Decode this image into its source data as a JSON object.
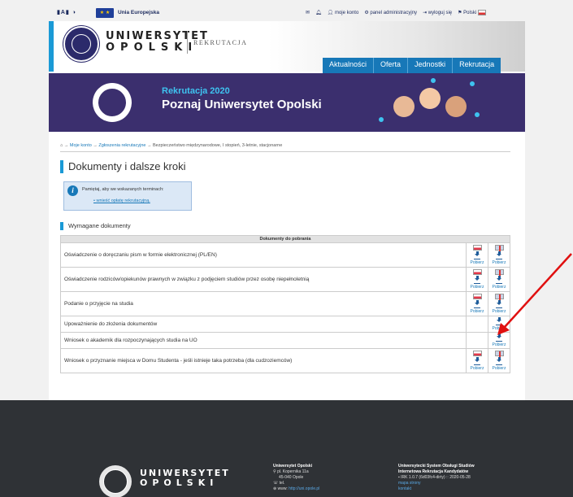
{
  "topbar": {
    "accessibility": "▮A▮ ◑",
    "eu_text": "Unia Europejska",
    "links": [
      "moje konto",
      "panel administracyjny",
      "wyloguj się",
      "Polski"
    ]
  },
  "header": {
    "brand_line1": "UNIWERSYTET",
    "brand_line2": "OPOLSKI",
    "section": "REKRUTACJA"
  },
  "nav": {
    "items": [
      "Aktualności",
      "Oferta",
      "Jednostki",
      "Rekrutacja"
    ]
  },
  "banner": {
    "line1": "Rekrutacja 2020",
    "line2": "Poznaj Uniwersytet Opolski"
  },
  "breadcrumb": {
    "items": [
      "Moje konto",
      "Zgłoszenia rekrutacyjne",
      "Bezpieczeństwo międzynarodowe, I stopień, 3-letnie, stacjonarne"
    ],
    "separator": "→"
  },
  "page_title": "Dokumenty i dalsze kroki",
  "notice": {
    "text": "Pamiętaj, aby we wskazanych terminach:",
    "link": "wnieść opłatę rekrutacyjną."
  },
  "section_title": "Wymagane dokumenty",
  "table": {
    "header": "Dokumenty do pobrania",
    "download_label": "Pobierz",
    "rows": [
      {
        "name": "Oświadczenie o doręczaniu pism w formie elektronicznej (PL/EN)",
        "pl": true,
        "en": true
      },
      {
        "name": "Oświadczenie rodziców/opiekunów prawnych w związku z podjęciem studiów przez osobę niepełnoletnią",
        "pl": true,
        "en": true
      },
      {
        "name": "Podanie o przyjęcie na studia",
        "pl": true,
        "en": true
      },
      {
        "name": "Upoważnienie do złożenia dokumentów",
        "pl": false,
        "en": true
      },
      {
        "name": "Wniosek o akademik dla rozpoczynających studia na UO",
        "pl": false,
        "en": true
      },
      {
        "name": "Wniosek o przyznanie miejsca w Domu Studenta - jeśli istnieje taka potrzeba (dla cudzoziemców)",
        "pl": true,
        "en": true
      }
    ]
  },
  "footer": {
    "brand_line1": "UNIWERSYTET",
    "brand_line2": "OPOLSKI",
    "col1": {
      "title": "Uniwersytet Opolski",
      "address1": "pl. Kopernika 11a",
      "address2": "45-040 Opole",
      "tel": "tel.",
      "www_label": "www:",
      "www": "http://uni.opole.pl"
    },
    "col2": {
      "title1": "Uniwersytecki System Obsługi Studiów",
      "title2": "Internetowa Rekrutacja Kandydatów",
      "version": "IRK 1.0.7 (6d03fc4-dirty) :: 2020-05-28",
      "link1": "mapa strony",
      "link2": "kontakt"
    }
  },
  "colors": {
    "accent": "#1a9ad6",
    "nav": "#1778b8",
    "banner": "#3b2f6e",
    "annotation_arrow": "#e01010"
  }
}
